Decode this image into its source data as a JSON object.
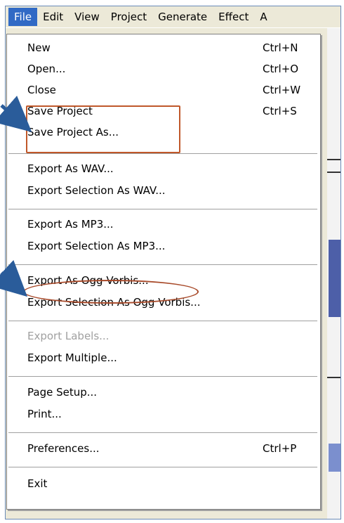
{
  "menubar": {
    "items": [
      "File",
      "Edit",
      "View",
      "Project",
      "Generate",
      "Effect",
      "A"
    ]
  },
  "file_menu": {
    "items": [
      {
        "label": "New",
        "shortcut": "Ctrl+N"
      },
      {
        "label": "Open...",
        "shortcut": "Ctrl+O"
      },
      {
        "label": "Close",
        "shortcut": "Ctrl+W"
      },
      {
        "label": "Save Project",
        "shortcut": "Ctrl+S"
      },
      {
        "label": "Save Project As...",
        "shortcut": ""
      },
      {
        "label": "Export As WAV...",
        "shortcut": ""
      },
      {
        "label": "Export Selection As WAV...",
        "shortcut": ""
      },
      {
        "label": "Export As MP3...",
        "shortcut": ""
      },
      {
        "label": "Export Selection As MP3...",
        "shortcut": ""
      },
      {
        "label": "Export As Ogg Vorbis...",
        "shortcut": ""
      },
      {
        "label": "Export Selection As Ogg Vorbis...",
        "shortcut": ""
      },
      {
        "label": "Export Labels...",
        "shortcut": "",
        "disabled": true
      },
      {
        "label": "Export Multiple...",
        "shortcut": ""
      },
      {
        "label": "Page Setup...",
        "shortcut": ""
      },
      {
        "label": "Print...",
        "shortcut": ""
      },
      {
        "label": "Preferences...",
        "shortcut": "Ctrl+P"
      },
      {
        "label": "Exit",
        "shortcut": ""
      }
    ]
  },
  "colors": {
    "menu_highlight": "#316ac5",
    "callout_stroke": "#c0582a",
    "arrow": "#2a5c9a"
  }
}
